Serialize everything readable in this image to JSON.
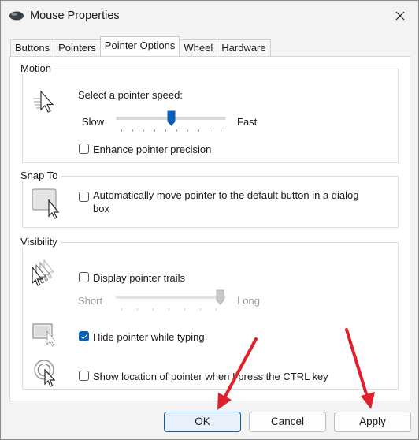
{
  "window": {
    "title": "Mouse Properties",
    "icon": "mouse-icon"
  },
  "tabs": [
    {
      "label": "Buttons",
      "active": false
    },
    {
      "label": "Pointers",
      "active": false
    },
    {
      "label": "Pointer Options",
      "active": true
    },
    {
      "label": "Wheel",
      "active": false
    },
    {
      "label": "Hardware",
      "active": false
    }
  ],
  "motion": {
    "label": "Motion",
    "speed_label": "Select a pointer speed:",
    "slow_label": "Slow",
    "fast_label": "Fast",
    "speed_value": 0.5,
    "precision_label": "Enhance pointer precision",
    "precision_checked": false
  },
  "snap_to": {
    "label": "Snap To",
    "option_line1": "Automatically move pointer to the default button in a dialog",
    "option_line2": "box",
    "checked": false
  },
  "visibility": {
    "label": "Visibility",
    "trails_label": "Display pointer trails",
    "trails_checked": false,
    "short_label": "Short",
    "long_label": "Long",
    "trail_length_value": 1.0,
    "hide_label": "Hide pointer while typing",
    "hide_checked": true,
    "show_location_label": "Show location of pointer when I press the CTRL key",
    "show_location_checked": false
  },
  "footer": {
    "ok_label": "OK",
    "cancel_label": "Cancel",
    "apply_label": "Apply"
  },
  "colors": {
    "accent": "#0a5fb4",
    "annotation_arrow": "#e0202a"
  }
}
